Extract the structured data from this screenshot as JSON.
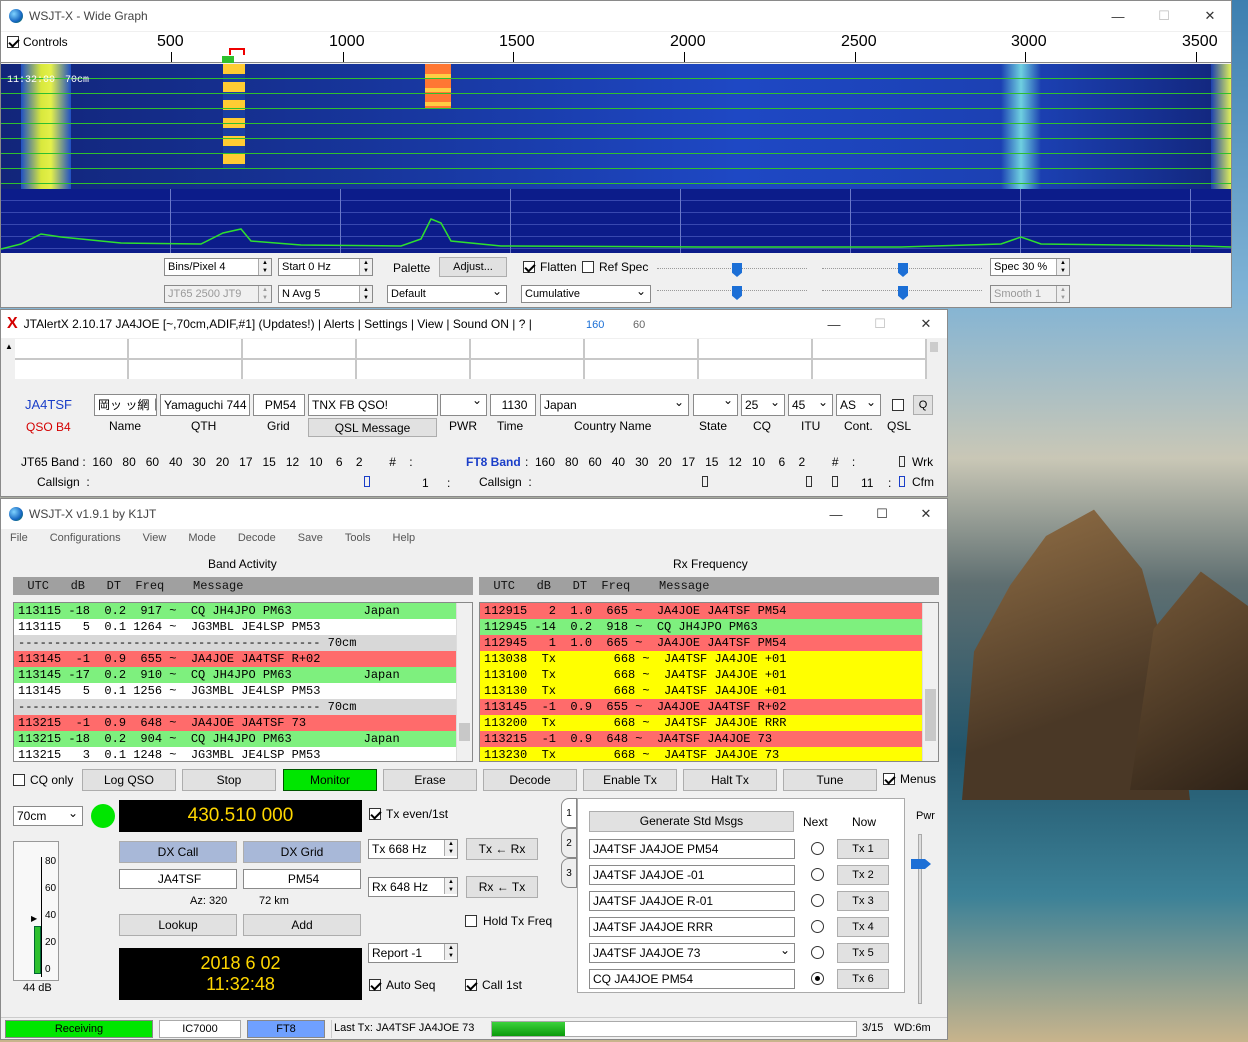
{
  "wide_graph": {
    "title": "WSJT-X - Wide Graph",
    "controls_label": "Controls",
    "scale_ticks": [
      "500",
      "1000",
      "1500",
      "2000",
      "2500",
      "3000",
      "3500"
    ],
    "wf_time": "11:32:00",
    "wf_band": "70cm",
    "bins": "Bins/Pixel  4",
    "start": "Start  0 Hz",
    "mode_spin": "JT65   2500   JT9",
    "navg": "N Avg  5",
    "palette_label": "Palette",
    "adjust": "Adjust...",
    "palette_value": "Default",
    "flatten": "Flatten",
    "ref_spec": "Ref Spec",
    "cumulative": "Cumulative",
    "spec": "Spec  30 %",
    "smooth": "Smooth   1"
  },
  "jtalert": {
    "title": "JTAlertX 2.10.17 JA4JOE [~,70cm,ADIF,#1] (Updates!) | Alerts | Settings | View | Sound ON | ? |",
    "t160": "160",
    "t60": "60",
    "callsign": "JA4TSF",
    "qso_b4": "QSO B4",
    "name_val": "岡ッ ッ網｜",
    "qth_val": "Yamaguchi 744",
    "grid_val": "PM54",
    "qsl_val": "TNX FB QSO!",
    "time_val": "1130",
    "country_val": "Japan",
    "cq_val": "25",
    "itu_val": "45",
    "cont_val": "AS",
    "q": "Q",
    "labels": {
      "name": "Name",
      "qth": "QTH",
      "grid": "Grid",
      "qsl": "QSL Message",
      "pwr": "PWR",
      "time": "Time",
      "country": "Country Name",
      "state": "State",
      "cq": "CQ",
      "itu": "ITU",
      "cont": "Cont.",
      "qslc": "QSL"
    },
    "jt65_band": "JT65 Band :  160   80   60   40   30   20   17   15   12   10    6    2        #    :",
    "jt65_callsign": "Callsign  :",
    "ft8_band_lbl": "FT8 Band",
    "ft8_band": ":  160   80   60   40   30   20   17   15   12   10    6    2        #    :",
    "ft8_callsign": "Callsign  :",
    "count1": "1",
    "count2": "11",
    "wrk": "Wrk",
    "cfm": "Cfm"
  },
  "wsjtx": {
    "title": "WSJT-X   v1.9.1   by K1JT",
    "menu": [
      "File",
      "Configurations",
      "View",
      "Mode",
      "Decode",
      "Save",
      "Tools",
      "Help"
    ],
    "band_activity": "Band Activity",
    "rx_frequency": "Rx Frequency",
    "hdr": "  UTC   dB   DT  Freq    Message",
    "left_rows": [
      {
        "t": "113115 -18  0.2  917 ~  CQ JH4JPO PM63          Japan",
        "c": "#7ef07e"
      },
      {
        "t": "113115   5  0.1 1264 ~  JG3MBL JE4LSP PM53",
        "c": "#ffffff"
      },
      {
        "t": "------------------------------------------ 70cm",
        "c": "#d8d8d8"
      },
      {
        "t": "113145  -1  0.9  655 ~  JA4JOE JA4TSF R+02",
        "c": "#ff6b6b"
      },
      {
        "t": "113145 -17  0.2  910 ~  CQ JH4JPO PM63          Japan",
        "c": "#7ef07e"
      },
      {
        "t": "113145   5  0.1 1256 ~  JG3MBL JE4LSP PM53",
        "c": "#ffffff"
      },
      {
        "t": "------------------------------------------ 70cm",
        "c": "#d8d8d8"
      },
      {
        "t": "113215  -1  0.9  648 ~  JA4JOE JA4TSF 73",
        "c": "#ff6b6b"
      },
      {
        "t": "113215 -18  0.2  904 ~  CQ JH4JPO PM63          Japan",
        "c": "#7ef07e"
      },
      {
        "t": "113215   3  0.1 1248 ~  JG3MBL JE4LSP PM53",
        "c": "#ffffff"
      }
    ],
    "right_rows": [
      {
        "t": "112915   2  1.0  665 ~  JA4JOE JA4TSF PM54",
        "c": "#ff6b6b"
      },
      {
        "t": "112945 -14  0.2  918 ~  CQ JH4JPO PM63",
        "c": "#7ef07e"
      },
      {
        "t": "112945   1  1.0  665 ~  JA4JOE JA4TSF PM54",
        "c": "#ff6b6b"
      },
      {
        "t": "113038  Tx        668 ~  JA4TSF JA4JOE +01",
        "c": "#ffff00"
      },
      {
        "t": "113100  Tx        668 ~  JA4TSF JA4JOE +01",
        "c": "#ffff00"
      },
      {
        "t": "113130  Tx        668 ~  JA4TSF JA4JOE +01",
        "c": "#ffff00"
      },
      {
        "t": "113145  -1  0.9  655 ~  JA4JOE JA4TSF R+02",
        "c": "#ff6b6b"
      },
      {
        "t": "113200  Tx        668 ~  JA4TSF JA4JOE RRR",
        "c": "#ffff00"
      },
      {
        "t": "113215  -1  0.9  648 ~  JA4TSF JA4JOE 73",
        "c": "#ff6b6b"
      },
      {
        "t": "113230  Tx        668 ~  JA4TSF JA4JOE 73",
        "c": "#ffff00"
      }
    ],
    "cq_only": "CQ only",
    "log_qso": "Log QSO",
    "stop": "Stop",
    "monitor": "Monitor",
    "erase": "Erase",
    "decode": "Decode",
    "enable_tx": "Enable Tx",
    "halt_tx": "Halt Tx",
    "tune": "Tune",
    "menus": "Menus",
    "band": "70cm",
    "freq": "430.510 000",
    "tx_even": "Tx even/1st",
    "dx_call_lbl": "DX Call",
    "dx_grid_lbl": "DX Grid",
    "dx_call": "JA4TSF",
    "dx_grid": "PM54",
    "az": "Az: 320",
    "km": "72 km",
    "lookup": "Lookup",
    "add": "Add",
    "date": "2018 6 02",
    "time": "11:32:48",
    "tx_hz": "Tx  668  Hz",
    "rx_hz": "Rx  648  Hz",
    "tx_rx": "Tx ← Rx",
    "rx_tx": "Rx ← Tx",
    "hold": "Hold Tx Freq",
    "report": "Report  -1",
    "auto_seq": "Auto Seq",
    "call1st": "Call 1st",
    "meter_ticks": [
      "80",
      "60",
      "40",
      "20",
      "0"
    ],
    "db": "44 dB",
    "meter_level": 0.44,
    "tabs": [
      "1",
      "2",
      "3"
    ],
    "gen": "Generate Std Msgs",
    "next": "Next",
    "now": "Now",
    "msgs": [
      "JA4TSF JA4JOE PM54",
      "JA4TSF JA4JOE -01",
      "JA4TSF JA4JOE R-01",
      "JA4TSF JA4JOE RRR",
      "JA4TSF JA4JOE 73",
      "CQ JA4JOE PM54"
    ],
    "tx_btns": [
      "Tx 1",
      "Tx 2",
      "Tx 3",
      "Tx 4",
      "Tx 5",
      "Tx 6"
    ],
    "pwr": "Pwr",
    "status": {
      "receiving": "Receiving",
      "rig": "IC7000",
      "mode": "FT8",
      "last_tx": "Last Tx: JA4TSF JA4JOE 73",
      "seq": "3/15",
      "wd": "WD:6m",
      "progress": 0.2
    }
  }
}
